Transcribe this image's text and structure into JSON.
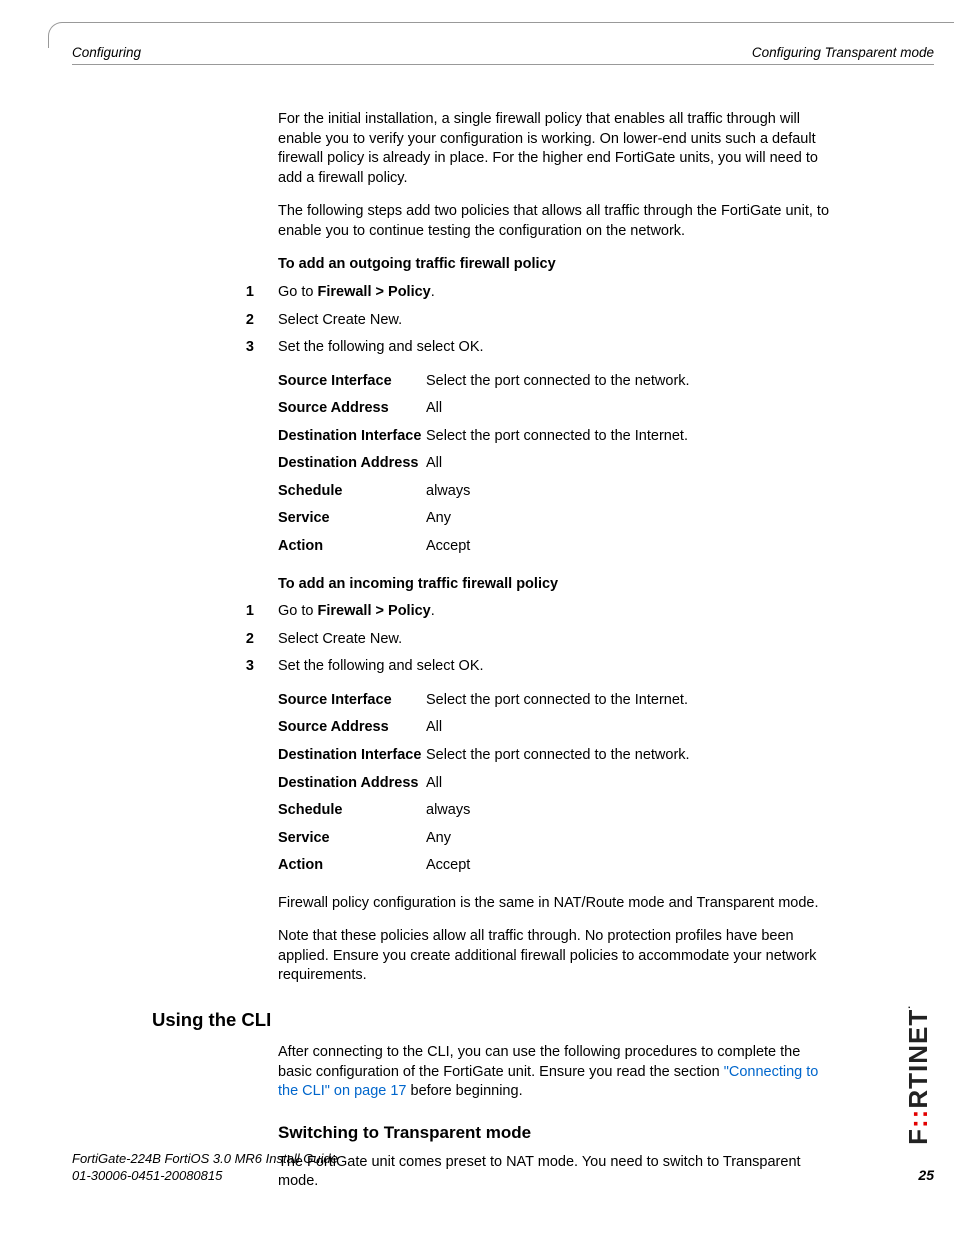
{
  "header": {
    "left": "Configuring",
    "right": "Configuring Transparent mode"
  },
  "intro_p1": "For the initial installation, a single firewall policy that enables all traffic through will enable you to verify your configuration is working. On lower-end units such a default firewall policy is already in place. For the higher end FortiGate units, you will need to add a firewall policy.",
  "intro_p2": "The following steps add two policies that allows all traffic through the FortiGate unit, to enable you to continue testing the configuration on the network.",
  "section_out": {
    "heading": "To add an outgoing traffic firewall policy",
    "step1_prefix": "Go to ",
    "step1_bold": "Firewall > Policy",
    "step1_suffix": ".",
    "step2": "Select Create New.",
    "step3": "Set the following and select OK.",
    "rows": [
      {
        "label": "Source Interface",
        "value": "Select the port connected to the network."
      },
      {
        "label": "Source Address",
        "value": "All"
      },
      {
        "label": "Destination Interface",
        "value": "Select the port connected to the Internet."
      },
      {
        "label": "Destination Address",
        "value": "All"
      },
      {
        "label": "Schedule",
        "value": "always"
      },
      {
        "label": "Service",
        "value": "Any"
      },
      {
        "label": "Action",
        "value": "Accept"
      }
    ]
  },
  "section_in": {
    "heading": "To add an incoming traffic firewall policy",
    "step1_prefix": "Go to ",
    "step1_bold": "Firewall > Policy",
    "step1_suffix": ".",
    "step2": "Select Create New.",
    "step3": "Set the following and select OK.",
    "rows": [
      {
        "label": "Source Interface",
        "value": "Select the port connected to the Internet."
      },
      {
        "label": "Source Address",
        "value": "All"
      },
      {
        "label": "Destination Interface",
        "value": "Select the port connected to the network."
      },
      {
        "label": "Destination Address",
        "value": "All"
      },
      {
        "label": "Schedule",
        "value": "always"
      },
      {
        "label": "Service",
        "value": "Any"
      },
      {
        "label": "Action",
        "value": "Accept"
      }
    ]
  },
  "after_p1": "Firewall policy configuration is the same in NAT/Route mode and Transparent mode.",
  "after_p2": "Note that these policies allow all traffic through. No protection profiles have been applied. Ensure you create additional firewall policies to accommodate your network requirements.",
  "cli_heading": "Using the CLI",
  "cli_p1_a": "After connecting to the CLI, you can use the following procedures to complete the basic configuration of the FortiGate unit. Ensure you read the section ",
  "cli_p1_link": "\"Connecting to the CLI\" on page 17",
  "cli_p1_b": " before beginning.",
  "switch_heading": "Switching to Transparent mode",
  "switch_p1": "The FortiGate unit comes preset to NAT mode. You need to switch to Transparent mode.",
  "footer": {
    "line1": "FortiGate-224B FortiOS 3.0 MR6 Install Guide",
    "line2": "01-30006-0451-20080815",
    "page": "25"
  },
  "brand_black": "F",
  "brand_red": "::",
  "brand_black2": "RTINET",
  "numbers": {
    "n1": "1",
    "n2": "2",
    "n3": "3"
  }
}
